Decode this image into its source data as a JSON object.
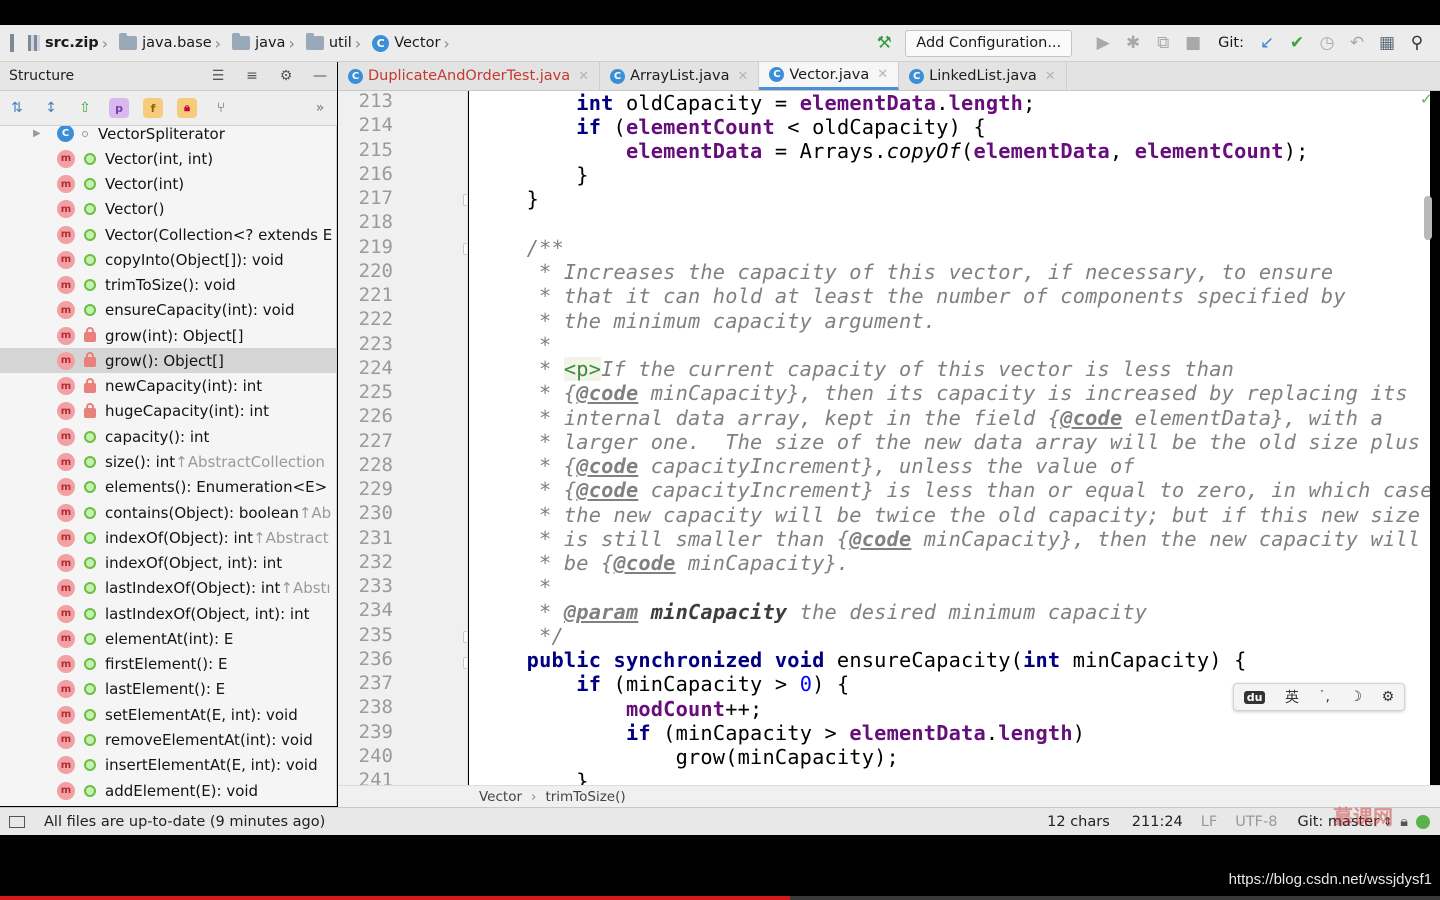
{
  "breadcrumb": {
    "items": [
      "src.zip",
      "java.base",
      "java",
      "util",
      "Vector"
    ]
  },
  "toolbar": {
    "add_configuration": "Add Configuration...",
    "git_label": "Git:"
  },
  "structure": {
    "title": "Structure",
    "rows": [
      {
        "text": "VectorSpliterator",
        "inherit": "",
        "icon": "class",
        "vis": "private-class"
      },
      {
        "text": "Vector(int, int)",
        "inherit": "",
        "icon": "method",
        "vis": "public"
      },
      {
        "text": "Vector(int)",
        "inherit": "",
        "icon": "method",
        "vis": "public"
      },
      {
        "text": "Vector()",
        "inherit": "",
        "icon": "method",
        "vis": "public"
      },
      {
        "text": "Vector(Collection<? extends E",
        "inherit": "",
        "icon": "method",
        "vis": "public"
      },
      {
        "text": "copyInto(Object[]): void",
        "inherit": "",
        "icon": "method",
        "vis": "public"
      },
      {
        "text": "trimToSize(): void",
        "inherit": "",
        "icon": "method",
        "vis": "public"
      },
      {
        "text": "ensureCapacity(int): void",
        "inherit": "",
        "icon": "method",
        "vis": "public"
      },
      {
        "text": "grow(int): Object[]",
        "inherit": "",
        "icon": "method",
        "vis": "private"
      },
      {
        "text": "grow(): Object[]",
        "inherit": "",
        "icon": "method",
        "vis": "private",
        "selected": true
      },
      {
        "text": "newCapacity(int): int",
        "inherit": "",
        "icon": "method",
        "vis": "private"
      },
      {
        "text": "hugeCapacity(int): int",
        "inherit": "",
        "icon": "method",
        "vis": "private"
      },
      {
        "text": "capacity(): int",
        "inherit": "",
        "icon": "method",
        "vis": "public"
      },
      {
        "text": "size(): int ",
        "inherit": "↑AbstractCollection",
        "icon": "method",
        "vis": "public"
      },
      {
        "text": "elements(): Enumeration<E>",
        "inherit": "",
        "icon": "method",
        "vis": "public"
      },
      {
        "text": "contains(Object): boolean ",
        "inherit": "↑Ab",
        "icon": "method",
        "vis": "public"
      },
      {
        "text": "indexOf(Object): int ",
        "inherit": "↑Abstract",
        "icon": "method",
        "vis": "public"
      },
      {
        "text": "indexOf(Object, int): int",
        "inherit": "",
        "icon": "method",
        "vis": "public"
      },
      {
        "text": "lastIndexOf(Object): int ",
        "inherit": "↑Abstı",
        "icon": "method",
        "vis": "public"
      },
      {
        "text": "lastIndexOf(Object, int): int",
        "inherit": "",
        "icon": "method",
        "vis": "public"
      },
      {
        "text": "elementAt(int): E",
        "inherit": "",
        "icon": "method",
        "vis": "public"
      },
      {
        "text": "firstElement(): E",
        "inherit": "",
        "icon": "method",
        "vis": "public"
      },
      {
        "text": "lastElement(): E",
        "inherit": "",
        "icon": "method",
        "vis": "public"
      },
      {
        "text": "setElementAt(E, int): void",
        "inherit": "",
        "icon": "method",
        "vis": "public"
      },
      {
        "text": "removeElementAt(int): void",
        "inherit": "",
        "icon": "method",
        "vis": "public"
      },
      {
        "text": "insertElementAt(E, int): void",
        "inherit": "",
        "icon": "method",
        "vis": "public"
      },
      {
        "text": "addElement(E): void",
        "inherit": "",
        "icon": "method",
        "vis": "public"
      }
    ]
  },
  "tabs": [
    {
      "label": "DuplicateAndOrderTest.java",
      "active": false,
      "modified": true
    },
    {
      "label": "ArrayList.java",
      "active": false,
      "modified": false
    },
    {
      "label": "Vector.java",
      "active": true,
      "modified": false
    },
    {
      "label": "LinkedList.java",
      "active": false,
      "modified": false
    }
  ],
  "editor": {
    "line_numbers": [
      "213",
      "214",
      "215",
      "216",
      "217",
      "218",
      "219",
      "220",
      "221",
      "222",
      "223",
      "224",
      "225",
      "226",
      "227",
      "228",
      "229",
      "230",
      "231",
      "232",
      "233",
      "234",
      "235",
      "236",
      "237",
      "238",
      "239",
      "240",
      "241"
    ],
    "breadcrumb": [
      "Vector",
      "trimToSize()"
    ]
  },
  "status": {
    "message": "All files are up-to-date (9 minutes ago)",
    "chars": "12 chars",
    "position": "211:24",
    "line_sep": "LF",
    "encoding": "UTF-8",
    "git_branch": "Git: master"
  },
  "ime": {
    "items": [
      "du",
      "英",
      "˙,",
      "☽",
      "⚙"
    ]
  },
  "watermark": {
    "url": "https://blog.csdn.net/wssjdysf1",
    "logo": "慕课网"
  },
  "colors": {
    "keyword": "#000080",
    "field": "#660e7a",
    "number": "#0000ff",
    "comment": "#808080",
    "method_icon": "#f2a0a3",
    "progress": "#d21a1a"
  }
}
